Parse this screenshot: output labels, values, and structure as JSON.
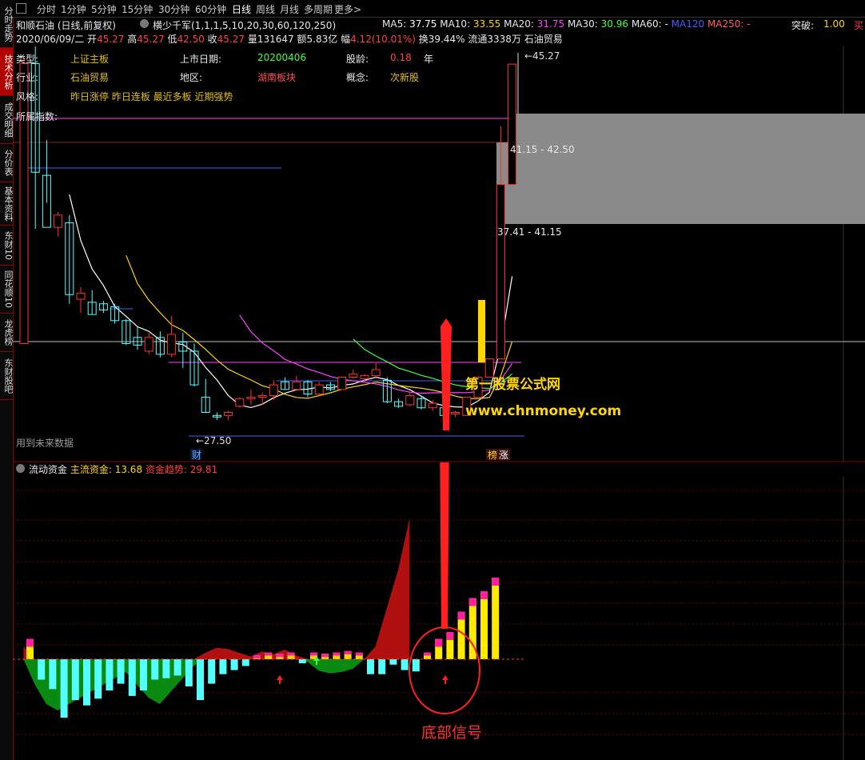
{
  "sidebar": {
    "tabs": [
      {
        "label": "分时走势",
        "active": false
      },
      {
        "label": "技术分析",
        "active": true
      },
      {
        "label": "成交明细",
        "active": false
      },
      {
        "label": "分价表",
        "active": false
      },
      {
        "label": "基本资料",
        "active": false
      },
      {
        "label": "东财10",
        "active": false
      },
      {
        "label": "同花顺10",
        "active": false
      },
      {
        "label": "龙虎榜",
        "active": false
      },
      {
        "label": "东财股吧",
        "active": false
      }
    ]
  },
  "toolbar": {
    "periods": [
      "分时",
      "1分钟",
      "5分钟",
      "15分钟",
      "30分钟",
      "60分钟",
      "日线",
      "周线",
      "月线",
      "多周期",
      "更多>"
    ],
    "active": "日线"
  },
  "header": {
    "stock_line": "和顺石油 (日线,前复权)",
    "indicator": "横少千军(1,1,1,5,10,20,30,60,120,250)",
    "ma": [
      {
        "label": "MA5:",
        "value": "37.75",
        "color": "#ffffff"
      },
      {
        "label": "MA10:",
        "value": "33.55",
        "color": "#ffd700"
      },
      {
        "label": "MA20:",
        "value": "31.75",
        "color": "#ff40ff"
      },
      {
        "label": "MA30:",
        "value": "30.96",
        "color": "#40ff40"
      },
      {
        "label": "MA60:",
        "value": "-",
        "color": "#e8e8e8"
      },
      {
        "label": "MA120",
        "value": "",
        "color": "#4060ff"
      },
      {
        "label": "MA250:",
        "value": "-",
        "color": "#ff6060"
      }
    ],
    "breakout_label": "突破:",
    "breakout_value": "1.00",
    "buy_label": "买",
    "quote": {
      "date": "2020/06/09/二",
      "open_label": "开",
      "open": "45.27",
      "high_label": "高",
      "high": "45.27",
      "low_label": "低",
      "low": "42.50",
      "close_label": "收",
      "close": "45.27",
      "vol_label": "量",
      "vol": "131647",
      "amt_label": "额",
      "amt": "5.83亿",
      "chg_label": "幅",
      "chg": "4.12(10.01%)",
      "turnover_label": "换",
      "turnover": "39.44%",
      "float_label": "流通",
      "float": "3338万",
      "sector": "石油贸易"
    }
  },
  "info": {
    "type_label": "类型:",
    "type_value": "上证主板",
    "list_label": "上市日期:",
    "list_value": "20200406",
    "age_label": "股龄:",
    "age_value": "0.18",
    "age_unit": "年",
    "industry_label": "行业:",
    "industry_value": "石油贸易",
    "region_label": "地区:",
    "region_value": "湖南板块",
    "concept_label": "概念:",
    "concept_value": "次新股",
    "style_label": "风格:",
    "style_value": "昨日涨停  昨日连板  最近多板  近期强势",
    "index_label": "所属指数:"
  },
  "chart_labels": {
    "price_top": "45.27",
    "price_low": "27.50",
    "range_high": "41.15 - 42.50",
    "range_mid": "37.41 - 41.15",
    "future_data": "用到未来数据",
    "cai_badge": "财",
    "bang_badge": "榜",
    "zhang_badge": "涨",
    "watermark_cn": "第一股票公式网",
    "watermark_url": "www.chnmoney.com"
  },
  "lower": {
    "name": "流动资金",
    "main_label": "主流资金:",
    "main_value": "13.68",
    "trend_label": "资金趋势:",
    "trend_value": "29.81",
    "annotation": "底部信号"
  },
  "colors": {
    "up": "#ff3030",
    "down": "#54ffff",
    "ma5": "#ffffff",
    "ma10": "#ffd700",
    "ma20": "#ff40ff",
    "ma30": "#40ff40",
    "grid": "#8b0000"
  },
  "chart_data": {
    "type": "candlestick",
    "period": "daily",
    "ohlc": [
      [
        27.0,
        45.8,
        27.0,
        45.3
      ],
      [
        45.3,
        47.2,
        34.5,
        38.2
      ],
      [
        38.0,
        40.3,
        36.2,
        34.6
      ],
      [
        34.6,
        35.6,
        34.0,
        35.4
      ],
      [
        34.9,
        35.4,
        29.6,
        30.2
      ],
      [
        29.9,
        30.7,
        29.0,
        30.3
      ],
      [
        29.7,
        30.5,
        28.9,
        28.9
      ],
      [
        29.6,
        29.8,
        29.0,
        29.2
      ],
      [
        29.4,
        29.6,
        28.3,
        28.5
      ],
      [
        28.5,
        28.6,
        26.9,
        27.0
      ],
      [
        27.4,
        28.1,
        26.6,
        26.9
      ],
      [
        26.5,
        27.7,
        26.3,
        27.4
      ],
      [
        27.4,
        27.8,
        26.1,
        26.3
      ],
      [
        26.3,
        28.8,
        26.1,
        27.6
      ],
      [
        27.1,
        27.7,
        25.4,
        26.5
      ],
      [
        26.5,
        27.0,
        24.2,
        24.3
      ],
      [
        23.5,
        24.7,
        22.5,
        22.5
      ],
      [
        22.3,
        22.5,
        22.0,
        22.2
      ],
      [
        22.3,
        22.6,
        22.0,
        22.5
      ],
      [
        22.9,
        23.5,
        22.8,
        23.4
      ],
      [
        23.4,
        24.0,
        23.0,
        23.5
      ],
      [
        23.5,
        23.8,
        23.0,
        23.6
      ],
      [
        23.6,
        24.6,
        23.3,
        24.3
      ],
      [
        24.5,
        24.8,
        24.0,
        24.0
      ],
      [
        24.0,
        24.9,
        24.0,
        24.5
      ],
      [
        24.5,
        24.6,
        23.5,
        23.7
      ],
      [
        23.7,
        24.5,
        23.6,
        24.3
      ],
      [
        24.3,
        24.5,
        23.9,
        24.0
      ],
      [
        24.0,
        24.8,
        24.0,
        24.8
      ],
      [
        24.8,
        25.3,
        24.7,
        25.0
      ],
      [
        24.7,
        25.0,
        24.5,
        24.9
      ],
      [
        24.9,
        25.8,
        24.7,
        25.3
      ],
      [
        24.6,
        24.8,
        23.1,
        23.2
      ],
      [
        23.2,
        23.4,
        22.8,
        22.9
      ],
      [
        23.0,
        23.8,
        22.9,
        23.6
      ],
      [
        23.4,
        23.6,
        22.7,
        22.8
      ],
      [
        22.8,
        23.3,
        22.6,
        23.1
      ],
      [
        22.8,
        23.0,
        22.2,
        22.3
      ],
      [
        22.4,
        22.6,
        22.2,
        22.5
      ],
      [
        22.3,
        23.5,
        22.3,
        23.5
      ],
      [
        23.5,
        24.8,
        23.5,
        24.8
      ],
      [
        24.8,
        26.0,
        24.8,
        26.0
      ],
      [
        26.0,
        41.2,
        26.0,
        37.4
      ],
      [
        37.4,
        45.27,
        37.4,
        45.27
      ]
    ],
    "price_labels": [
      "45.27",
      "27.50"
    ],
    "flow_values": [
      1.5,
      -1.5,
      -2.2,
      -4.3,
      -3.0,
      -3.4,
      -2.9,
      -2.3,
      -1.8,
      -2.7,
      -2.3,
      -1.5,
      -1.4,
      -1.2,
      -2.0,
      -3.0,
      -1.8,
      -1.1,
      -0.8,
      -0.5,
      0.3,
      0.5,
      0.4,
      0.5,
      -0.3,
      0.5,
      0.4,
      0.5,
      0.6,
      0.5,
      -1.1,
      -1.1,
      -0.4,
      -0.8,
      -0.9,
      0.5,
      1.5,
      2.0,
      3.5,
      4.5,
      5.0,
      6.0
    ],
    "trend_series": [
      2.0,
      -4.0,
      -7.0,
      -8.0,
      -7.0,
      -6.0,
      -5.0,
      -4.0,
      -3.0,
      -2.0,
      -4.0,
      -6.0,
      -7.0,
      -5.0,
      -3.0,
      -1.0,
      1.0,
      1.8,
      1.6,
      1.0,
      0.4,
      1.2,
      0.8,
      1.5,
      0.6,
      -0.4,
      -1.8,
      -2.2,
      -2.0,
      -1.5,
      0.0,
      2.0,
      8.0,
      14.0,
      22.0
    ]
  }
}
